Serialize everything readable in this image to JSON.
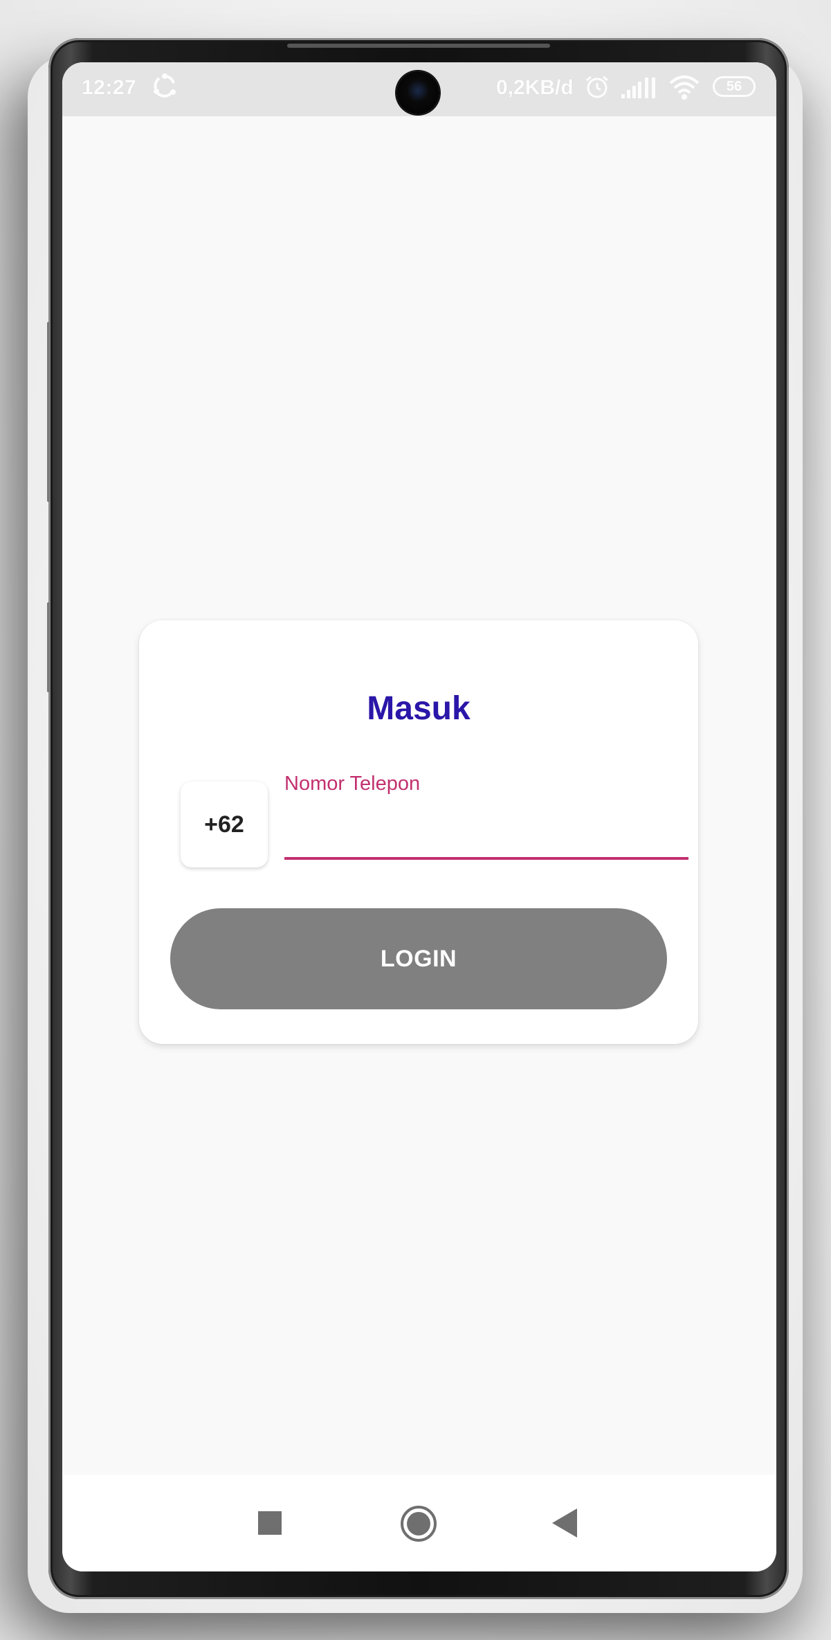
{
  "status_bar": {
    "time": "12:27",
    "data_rate": "0,2KB/d",
    "battery_level": "56",
    "icons": [
      "sync-icon",
      "alarm-icon",
      "signal-icon",
      "wifi-icon",
      "battery-icon"
    ]
  },
  "login_card": {
    "title": "Masuk",
    "country_code": "+62",
    "phone_label": "Nomor Telepon",
    "phone_value": "",
    "login_label": "LOGIN"
  },
  "nav_bar": {
    "icons": [
      "recents-square-icon",
      "home-circle-icon",
      "back-triangle-icon"
    ]
  },
  "colors": {
    "title": "#2a16a8",
    "accent": "#c2306e",
    "button": "#808080",
    "background": "#f9f9f9"
  }
}
